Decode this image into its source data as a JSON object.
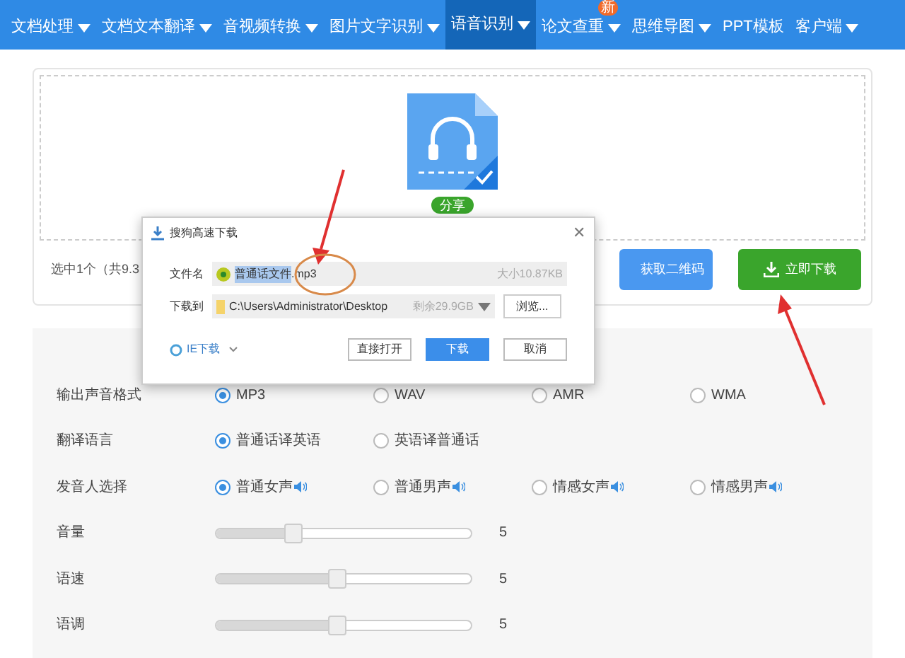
{
  "nav": {
    "items": [
      {
        "label": "文档处理",
        "dropdown": true,
        "selected": false
      },
      {
        "label": "文档文本翻译",
        "dropdown": true,
        "selected": false
      },
      {
        "label": "音视频转换",
        "dropdown": true,
        "selected": false
      },
      {
        "label": "图片文字识别",
        "dropdown": true,
        "selected": false
      },
      {
        "label": "语音识别",
        "dropdown": true,
        "selected": true
      },
      {
        "label": "论文查重",
        "dropdown": true,
        "selected": false,
        "badge": "新"
      },
      {
        "label": "思维导图",
        "dropdown": true,
        "selected": false
      },
      {
        "label": "PPT模板",
        "dropdown": false,
        "selected": false
      },
      {
        "label": "客户端",
        "dropdown": true,
        "selected": false
      }
    ]
  },
  "file": {
    "share": "分享"
  },
  "actions": {
    "summary": "选中1个（共9.3",
    "qr_button": "获取二维码",
    "download_button": "立即下载"
  },
  "settings": [
    {
      "kind": "radio",
      "label": "输出声音格式",
      "options": [
        {
          "label": "MP3",
          "selected": true,
          "speaker": false
        },
        {
          "label": "WAV",
          "selected": false,
          "speaker": false
        },
        {
          "label": "AMR",
          "selected": false,
          "speaker": false
        },
        {
          "label": "WMA",
          "selected": false,
          "speaker": false
        }
      ]
    },
    {
      "kind": "radio",
      "label": "翻译语言",
      "options": [
        {
          "label": "普通话译英语",
          "selected": true,
          "speaker": false
        },
        {
          "label": "英语译普通话",
          "selected": false,
          "speaker": false
        }
      ]
    },
    {
      "kind": "radio",
      "label": "发音人选择",
      "options": [
        {
          "label": "普通女声",
          "selected": true,
          "speaker": true
        },
        {
          "label": "普通男声",
          "selected": false,
          "speaker": true
        },
        {
          "label": "情感女声",
          "selected": false,
          "speaker": true
        },
        {
          "label": "情感男声",
          "selected": false,
          "speaker": true
        }
      ]
    },
    {
      "kind": "slider",
      "label": "音量",
      "level": 0.3,
      "reading": "5"
    },
    {
      "kind": "slider",
      "label": "语速",
      "level": 0.47,
      "reading": "5"
    },
    {
      "kind": "slider",
      "label": "语调",
      "level": 0.47,
      "reading": "5"
    }
  ],
  "dialog": {
    "title": "搜狗高速下载",
    "close": "✕",
    "filename_label": "文件名",
    "filename_selected": "普通话文件",
    "filename_rest": ".mp3",
    "size": "大小10.87KB",
    "path_label": "下载到",
    "path": "C:\\Users\\Administrator\\Desktop",
    "free": "剩余29.9GB",
    "browse": "浏览...",
    "ie": "IE下载",
    "buttons": [
      {
        "label": "直接打开",
        "primary": false
      },
      {
        "label": "下载",
        "primary": true
      },
      {
        "label": "取消",
        "primary": false
      }
    ]
  }
}
